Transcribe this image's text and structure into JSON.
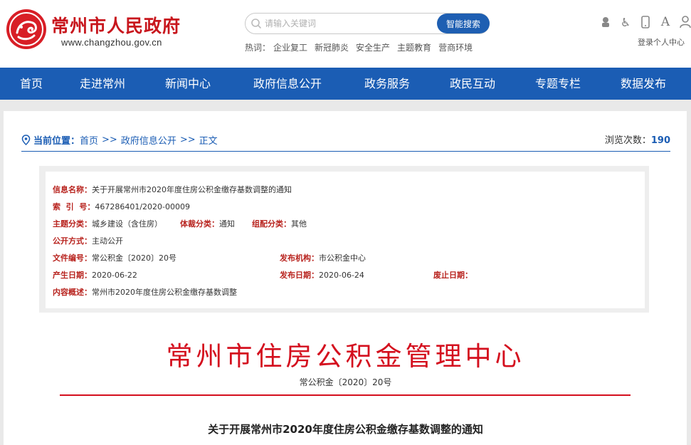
{
  "header": {
    "site_title": "常州市人民政府",
    "site_url": "www.changzhou.gov.cn",
    "search_placeholder": "请输入关键词",
    "search_button": "智能搜索",
    "hot_label": "热词：",
    "hot_words": [
      "企业复工",
      "新冠肺炎",
      "安全生产",
      "主题教育",
      "营商环境"
    ],
    "tool_a_label": "A",
    "user_center": "登录个人中心"
  },
  "nav": {
    "items": [
      "首页",
      "走进常州",
      "新闻中心",
      "政府信息公开",
      "政务服务",
      "政民互动",
      "专题专栏",
      "数据发布"
    ]
  },
  "breadcrumb": {
    "label": "当前位置：",
    "items": [
      "首页",
      "政府信息公开",
      "正文"
    ],
    "separator": ">>",
    "views_label": "浏览次数：",
    "views_count": "190"
  },
  "info": {
    "name_label": "信息名称：",
    "name_value": "关于开展常州市2020年度住房公积金缴存基数调整的通知",
    "index_label": "索  引  号：",
    "index_value": "467286401/2020-00009",
    "topic_label": "主题分类：",
    "topic_value": "城乡建设（含住房）",
    "genre_label": "体裁分类：",
    "genre_value": "通知",
    "org_cat_label": "组配分类：",
    "org_cat_value": "其他",
    "open_label": "公开方式：",
    "open_value": "主动公开",
    "docno_label": "文件编号：",
    "docno_value": "常公积金〔2020〕20号",
    "publisher_label": "发布机构：",
    "publisher_value": "市公积金中心",
    "created_label": "产生日期：",
    "created_value": "2020-06-22",
    "published_label": "发布日期：",
    "published_value": "2020-06-24",
    "expire_label": "废止日期：",
    "expire_value": "",
    "summary_label": "内容概述：",
    "summary_value": "常州市2020年度住房公积金缴存基数调整"
  },
  "document": {
    "agency_title": "常州市住房公积金管理中心",
    "doc_number": "常公积金〔2020〕20号",
    "doc_title": "关于开展常州市2020年度住房公积金缴存基数调整的通知"
  },
  "colors": {
    "primary_blue": "#1b5db4",
    "title_red": "#c8161d",
    "agency_red": "#d40f1e",
    "label_red": "#b8231e"
  }
}
